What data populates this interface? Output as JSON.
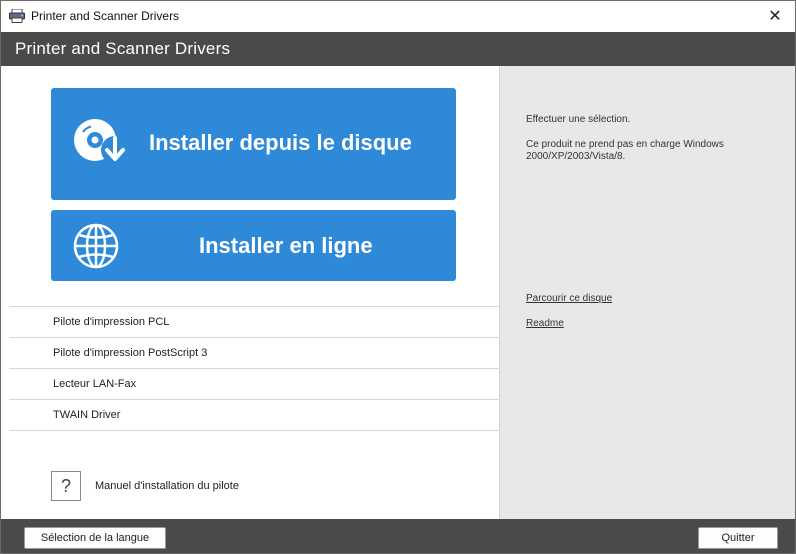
{
  "window": {
    "title": "Printer and Scanner Drivers",
    "close_glyph": "✕",
    "app_icon": "printer-scanner-icon"
  },
  "header": {
    "title": "Printer and Scanner Drivers"
  },
  "buttons": {
    "disk": {
      "label": "Installer depuis le disque",
      "icon": "disc-download-icon"
    },
    "online": {
      "label": "Installer en ligne",
      "icon": "globe-icon"
    }
  },
  "drivers": [
    {
      "label": "Pilote d'impression PCL"
    },
    {
      "label": "Pilote d'impression PostScript 3"
    },
    {
      "label": "Lecteur LAN-Fax"
    },
    {
      "label": "TWAIN Driver"
    }
  ],
  "manual": {
    "glyph": "?",
    "label": "Manuel d'installation du pilote"
  },
  "info": {
    "select_msg": "Effectuer une sélection.",
    "support_msg": "Ce produit ne prend pas en charge Windows 2000/XP/2003/Vista/8."
  },
  "links": {
    "browse": "Parcourir ce disque",
    "readme": "Readme"
  },
  "footer": {
    "language_button": "Sélection de la langue",
    "quit_button": "Quitter"
  },
  "colors": {
    "accent": "#2f89d9",
    "header_bg": "#4a4a4a",
    "side_bg": "#e8e8e8"
  }
}
